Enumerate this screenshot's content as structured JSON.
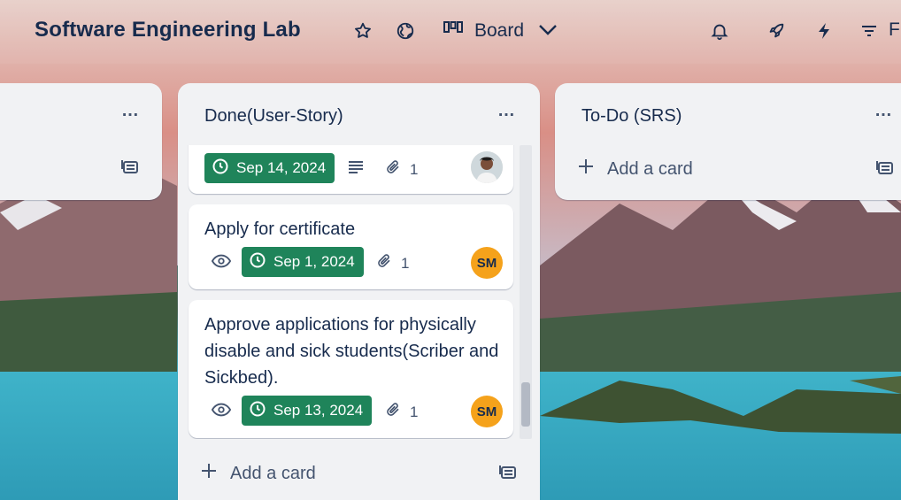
{
  "board": {
    "title": "Software Engineering Lab",
    "view_label": "Board",
    "filter_label": "F"
  },
  "colors": {
    "due_complete": "#1f845a",
    "avatar_sm": "#f5a21b"
  },
  "lists": [
    {
      "title": "",
      "menu": "…"
    },
    {
      "title": "Done(User-Story)",
      "menu": "…",
      "cards": [
        {
          "title": "",
          "due": "Sep 14, 2024",
          "has_description": true,
          "attachments": "1",
          "member": "photo"
        },
        {
          "title": "Apply for certificate",
          "watching": true,
          "due": "Sep 1, 2024",
          "attachments": "1",
          "member": "SM"
        },
        {
          "title": "Approve applications for physically disable and sick students(Scriber and Sickbed).",
          "watching": true,
          "due": "Sep 13, 2024",
          "attachments": "1",
          "member": "SM"
        }
      ],
      "add_card": "Add a card"
    },
    {
      "title": "To-Do (SRS)",
      "menu": "…",
      "add_card": "Add a card"
    }
  ],
  "icons": [
    "star-icon",
    "globe-icon",
    "board-icon",
    "chevron-down-icon",
    "bell-icon",
    "rocket-icon",
    "lightning-icon",
    "filter-icon",
    "clock-icon",
    "description-icon",
    "paperclip-icon",
    "eye-icon",
    "plus-icon",
    "template-icon"
  ]
}
